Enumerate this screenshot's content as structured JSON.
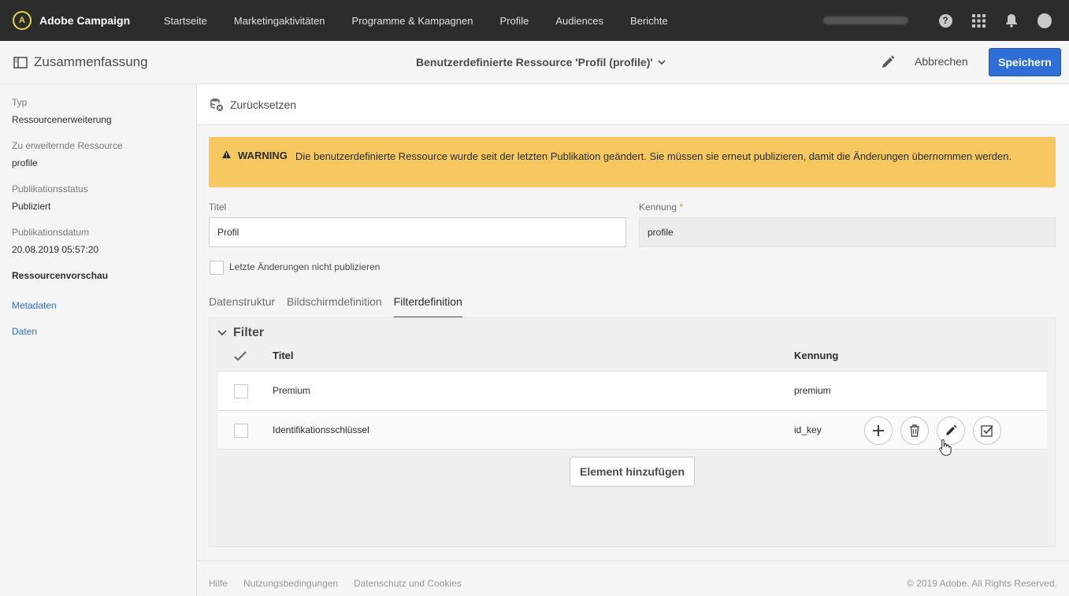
{
  "app": {
    "brand": "Adobe Campaign",
    "logo_glyph": "A"
  },
  "nav": {
    "items": [
      "Startseite",
      "Marketingaktivitäten",
      "Programme & Kampagnen",
      "Profile",
      "Audiences",
      "Berichte"
    ]
  },
  "topbar": {
    "help_glyph": "?"
  },
  "header": {
    "summary_label": "Zusammenfassung",
    "resource_title": "Benutzerdefinierte Ressource 'Profil (profile)'",
    "cancel_label": "Abbrechen",
    "save_label": "Speichern"
  },
  "sidebar": {
    "type_label": "Typ",
    "type_value": "Ressourcenerweiterung",
    "resource_label": "Zu erweiternde Ressource",
    "resource_value": "profile",
    "status_label": "Publikationsstatus",
    "status_value": "Publiziert",
    "date_label": "Publikationsdatum",
    "date_value": "20.08.2019 05:57:20",
    "preview_label": "Ressourcenvorschau",
    "links": [
      "Metadaten",
      "Daten"
    ]
  },
  "reset": {
    "label": "Zurücksetzen"
  },
  "warning": {
    "title": "WARNING",
    "text": "Die benutzerdefinierte Ressource wurde seit der letzten Publikation geändert. Sie müssen sie erneut publizieren, damit die Änderungen übernommen werden."
  },
  "form": {
    "title_label": "Titel",
    "title_value": "Profil",
    "id_label": "Kennung",
    "id_required": "*",
    "id_value": "profile",
    "nopublish_label": "Letzte Änderungen nicht publizieren"
  },
  "tabs": [
    "Datenstruktur",
    "Bildschirmdefinition",
    "Filterdefinition"
  ],
  "active_tab": "Filterdefinition",
  "filter": {
    "section_title": "Filter",
    "col_title": "Titel",
    "col_id": "Kennung",
    "rows": [
      {
        "title": "Premium",
        "id": "premium"
      },
      {
        "title": "Identifikationsschlüssel",
        "id": "id_key"
      }
    ],
    "add_label": "Element hinzufügen"
  },
  "footer": {
    "links": [
      "Hilfe",
      "Nutzungsbedingungen",
      "Datenschutz und Cookies"
    ],
    "copyright": "© 2019 Adobe. All Rights Reserved."
  },
  "colors": {
    "primary": "#2d6fd6",
    "warning": "#f6c85f",
    "topbar": "#2c2c2c",
    "link": "#2d6fd6"
  }
}
